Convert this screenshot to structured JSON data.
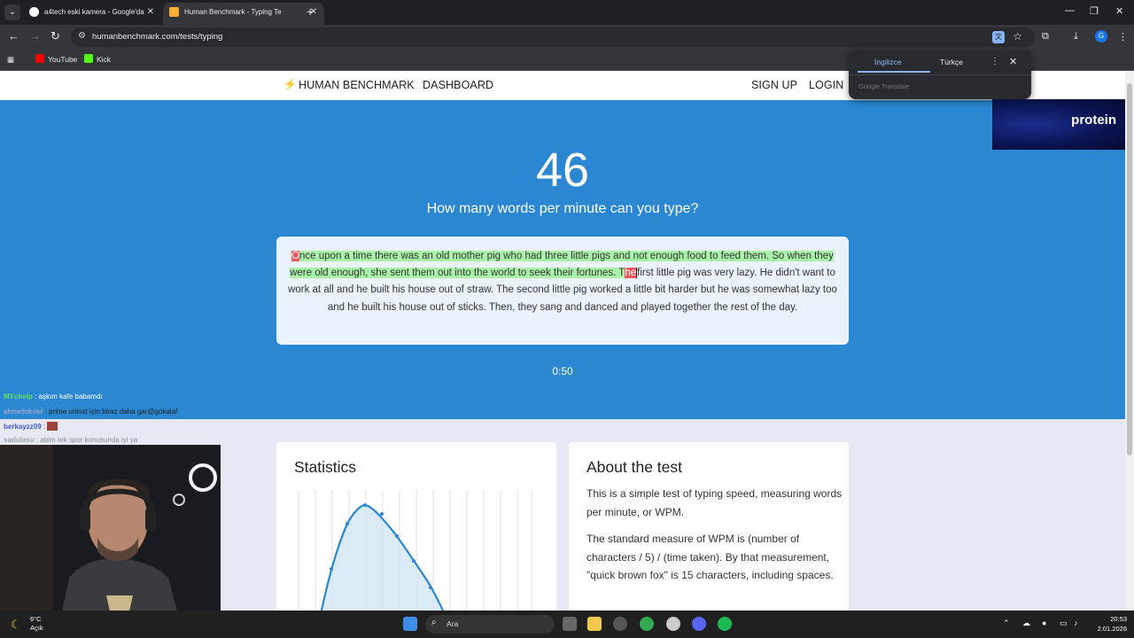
{
  "browser": {
    "tabs": [
      {
        "title": "a4tech eski kamera - Google'da"
      },
      {
        "title": "Human Benchmark - Typing Te"
      }
    ],
    "url": "humanbenchmark.com/tests/typing",
    "profile_initial": "G",
    "bookmarks": [
      {
        "label": "YouTube",
        "color": "#ff0000"
      },
      {
        "label": "Kick",
        "color": "#53fc18"
      }
    ]
  },
  "translate_popup": {
    "source_lang": "İngilizce",
    "target_lang": "Türkçe",
    "provider": "Google Translate"
  },
  "site_nav": {
    "brand": "HUMAN BENCHMARK",
    "dashboard": "DASHBOARD",
    "signup": "SIGN UP",
    "login": "LOGIN"
  },
  "test": {
    "wpm": "46",
    "question": "How many words per minute can you type?",
    "typed_error": "O",
    "typed_correct_1": "nce upon a time there was an old mother pig who had three little pigs and not enough food to feed them. So when they were old enough, she sent them out into the world to seek their fortunes. T",
    "typed_error_2": "he",
    "remaining": "first little pig was very lazy. He didn't want to work at all and he built his house out of straw. The second little pig worked a little bit harder but he was somewhat lazy too and he built his house out of sticks. Then, they sang and danced and played together the rest of the day.",
    "timer": "0:50"
  },
  "statistics": {
    "heading": "Statistics"
  },
  "about": {
    "heading": "About the test",
    "para1": "This is a simple test of typing speed, measuring words per minute, or WPM.",
    "para2": "The standard measure of WPM is (number of characters / 5) / (time taken). By that measurement, \"quick brown fox\" is 15 characters, including spaces."
  },
  "ad": {
    "brand": "protein"
  },
  "chat": [
    {
      "user": "MYchelp",
      "message": ": aşkım kafe babamdı",
      "user_color": "#5fe05f"
    },
    {
      "user": "ahmetckver",
      "message": ": prime unlost için biraz daha gar@gokalaf",
      "user_color": "#9aa4c8"
    },
    {
      "user": "berkayzz09",
      "message": ":",
      "user_color": "#9fb8ff"
    },
    {
      "user": "sadulasu",
      "message": ": abim tek spor konusunda iyi ya",
      "user_color": "#b0b0b0"
    }
  ],
  "taskbar": {
    "temperature": "6°C",
    "weather": "Açık",
    "search_label": "Ara",
    "time": "20:53",
    "date": "2.01.2026"
  }
}
